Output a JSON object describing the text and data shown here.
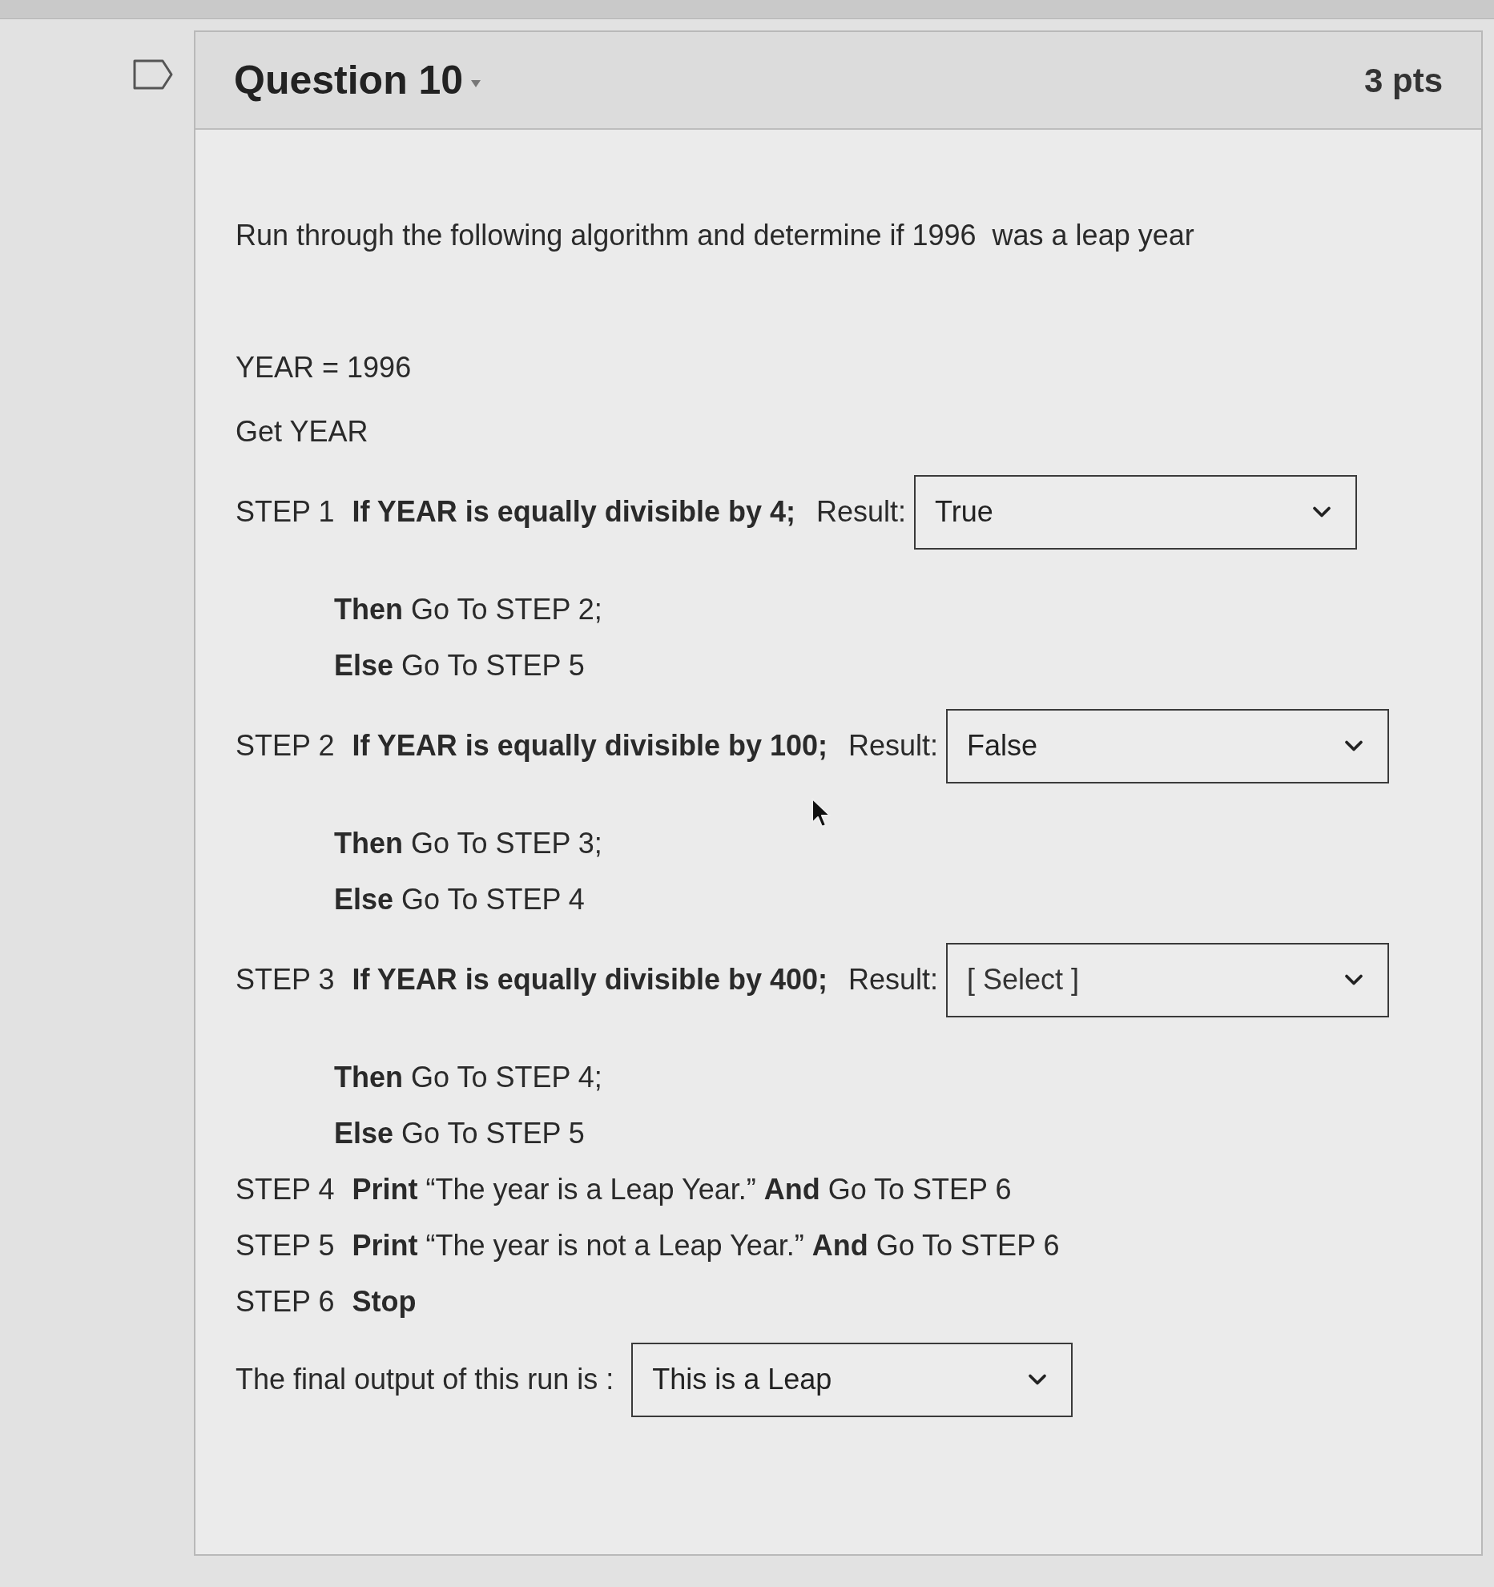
{
  "question": {
    "title": "Question 10",
    "points": "3 pts"
  },
  "prompt": "Run through the following algorithm and determine if 1996  was a leap year",
  "lines": [
    {
      "kind": "plain",
      "text": "YEAR = 1996"
    },
    {
      "kind": "plain",
      "text": "Get YEAR"
    },
    {
      "kind": "step",
      "label": "STEP 1",
      "text": "**If YEAR is equally divisible by 4;**",
      "result_label": "Result:",
      "dropdown": {
        "value": "True"
      }
    },
    {
      "kind": "branch",
      "text": "**Then** Go To STEP 2;"
    },
    {
      "kind": "branch",
      "text": "**Else** Go To STEP 5"
    },
    {
      "kind": "step",
      "label": "STEP 2",
      "text": "**If YEAR is equally divisible by 100;**",
      "result_label": "Result:",
      "dropdown": {
        "value": "False"
      }
    },
    {
      "kind": "branch",
      "text": "**Then** Go To STEP 3;"
    },
    {
      "kind": "branch",
      "text": "**Else** Go To STEP 4"
    },
    {
      "kind": "step",
      "label": "STEP 3",
      "text": "**If YEAR is equally divisible by 400;**",
      "result_label": "Result:",
      "dropdown": {
        "placeholder": "[ Select ]"
      }
    },
    {
      "kind": "branch",
      "text": "**Then** Go To STEP 4;"
    },
    {
      "kind": "branch",
      "text": "**Else** Go To STEP 5"
    },
    {
      "kind": "step",
      "label": "STEP 4",
      "text": "**Print** “The year is a Leap Year.” **And** Go To STEP 6"
    },
    {
      "kind": "step",
      "label": "STEP 5",
      "text": "**Print** “The year is not a Leap Year.” **And** Go To STEP 6"
    },
    {
      "kind": "step",
      "label": "STEP 6",
      "text": "**Stop**"
    }
  ],
  "final": {
    "label": "The final output of this run is :",
    "dropdown": {
      "value": "This is a Leap"
    }
  }
}
